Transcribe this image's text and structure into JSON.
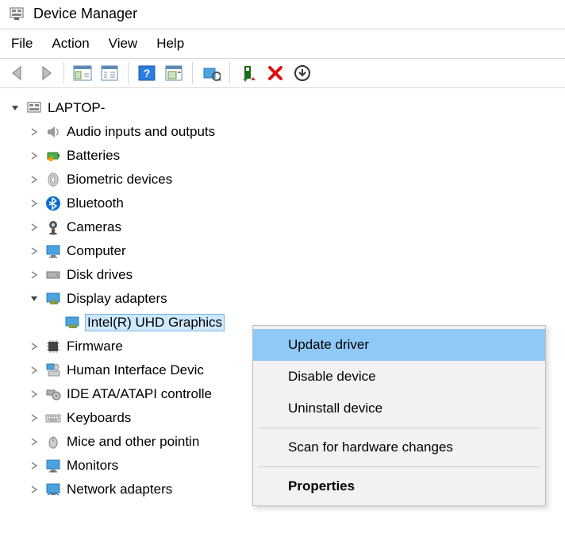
{
  "window": {
    "title": "Device Manager"
  },
  "menubar": {
    "file": "File",
    "action": "Action",
    "view": "View",
    "help": "Help"
  },
  "tree": {
    "root": "LAPTOP-",
    "items": [
      "Audio inputs and outputs",
      "Batteries",
      "Biometric devices",
      "Bluetooth",
      "Cameras",
      "Computer",
      "Disk drives",
      "Display adapters",
      "Firmware",
      "Human Interface Devic",
      "IDE ATA/ATAPI controlle",
      "Keyboards",
      "Mice and other pointin",
      "Monitors",
      "Network adapters"
    ],
    "display_child": "Intel(R) UHD Graphics"
  },
  "context_menu": {
    "update": "Update driver",
    "disable": "Disable device",
    "uninstall": "Uninstall device",
    "scan": "Scan for hardware changes",
    "properties": "Properties"
  }
}
